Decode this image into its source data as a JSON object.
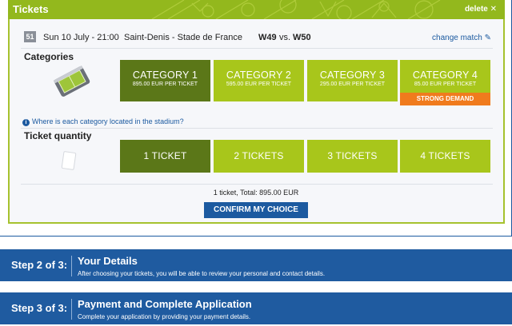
{
  "tickets_panel": {
    "title": "Tickets",
    "delete_label": "delete ✕",
    "match": {
      "number": "51",
      "date": "Sun 10 July - 21:00",
      "venue": "Saint-Denis - Stade de France",
      "team1": "W49",
      "vs": "vs.",
      "team2": "W50",
      "change_label": "change match ✎"
    },
    "categories_label": "Categories",
    "categories": [
      {
        "name": "CATEGORY 1",
        "price": "895.00 EUR PER TICKET",
        "selected": true
      },
      {
        "name": "CATEGORY 2",
        "price": "595.00 EUR PER TICKET",
        "selected": false
      },
      {
        "name": "CATEGORY 3",
        "price": "295.00 EUR PER TICKET",
        "selected": false
      },
      {
        "name": "CATEGORY 4",
        "price": "85.00 EUR PER TICKET",
        "selected": false
      }
    ],
    "strong_demand": "STRONG DEMAND",
    "info_icon": "i",
    "info_link": "Where is each category located in the stadium?",
    "quantity_label": "Ticket quantity",
    "quantities": [
      {
        "label": "1 TICKET",
        "selected": true
      },
      {
        "label": "2 TICKETS",
        "selected": false
      },
      {
        "label": "3 TICKETS",
        "selected": false
      },
      {
        "label": "4 TICKETS",
        "selected": false
      }
    ],
    "total": "1 ticket, Total: 895.00 EUR",
    "confirm_label": "CONFIRM MY CHOICE"
  },
  "steps": [
    {
      "number": "Step 2 of 3:",
      "title": "Your Details",
      "description": "After choosing your tickets, you will be able to review your personal and contact details."
    },
    {
      "number": "Step 3 of 3:",
      "title": "Payment and Complete Application",
      "description": "Complete your application by providing your payment details."
    }
  ],
  "colors": {
    "accent_green": "#a8c61b",
    "selected_green": "#5b7718",
    "brand_blue": "#1f5ba0",
    "demand_orange": "#f07b1d"
  }
}
